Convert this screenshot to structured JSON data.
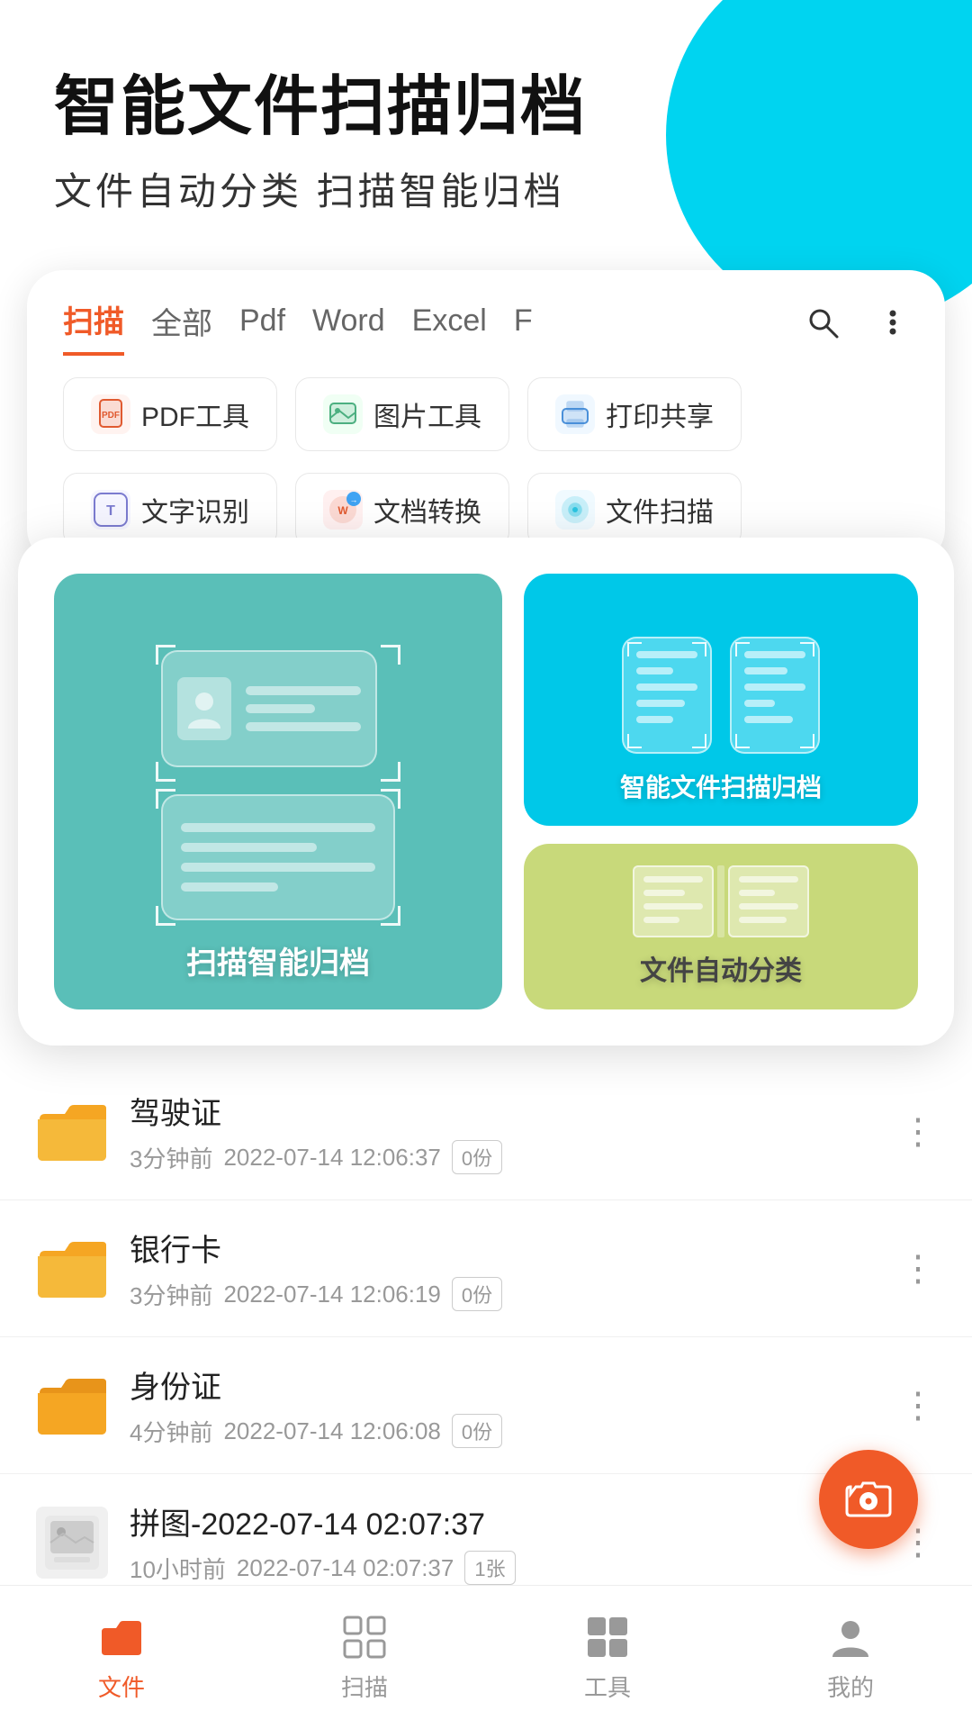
{
  "header": {
    "title": "智能文件扫描归档",
    "subtitle": "文件自动分类   扫描智能归档"
  },
  "tabs": {
    "items": [
      {
        "label": "扫描",
        "active": true
      },
      {
        "label": "全部",
        "active": false
      },
      {
        "label": "Pdf",
        "active": false
      },
      {
        "label": "Word",
        "active": false
      },
      {
        "label": "Excel",
        "active": false
      },
      {
        "label": "F",
        "active": false
      }
    ]
  },
  "tools": {
    "row1": [
      {
        "icon": "pdf-icon",
        "label": "PDF工具"
      },
      {
        "icon": "image-icon",
        "label": "图片工具"
      },
      {
        "icon": "print-icon",
        "label": "打印共享"
      }
    ],
    "row2": [
      {
        "icon": "text-icon",
        "label": "文字识别"
      },
      {
        "icon": "convert-icon",
        "label": "文档转换"
      },
      {
        "icon": "scan-icon",
        "label": "文件扫描"
      }
    ]
  },
  "features": {
    "left": {
      "label": "扫描智能归档"
    },
    "right_top": {
      "label": "智能文件扫描归档"
    },
    "right_bottom": {
      "label": "文件自动分类"
    }
  },
  "files": [
    {
      "name": "驾驶证",
      "time": "3分钟前",
      "date": "2022-07-14 12:06:37",
      "count": "0份",
      "type": "folder"
    },
    {
      "name": "银行卡",
      "time": "3分钟前",
      "date": "2022-07-14 12:06:19",
      "count": "0份",
      "type": "folder"
    },
    {
      "name": "身份证",
      "time": "4分钟前",
      "date": "2022-07-14 12:06:08",
      "count": "0份",
      "type": "folder"
    },
    {
      "name": "拼图-2022-07-14 02:07:37",
      "time": "10小时前",
      "date": "2022-07-14 02:07:37",
      "count": "1张",
      "type": "image"
    }
  ],
  "nav": {
    "items": [
      {
        "icon": "file-nav-icon",
        "label": "文件",
        "active": true
      },
      {
        "icon": "scan-nav-icon",
        "label": "扫描",
        "active": false
      },
      {
        "icon": "tools-nav-icon",
        "label": "工具",
        "active": false
      },
      {
        "icon": "mine-nav-icon",
        "label": "我的",
        "active": false
      }
    ]
  }
}
